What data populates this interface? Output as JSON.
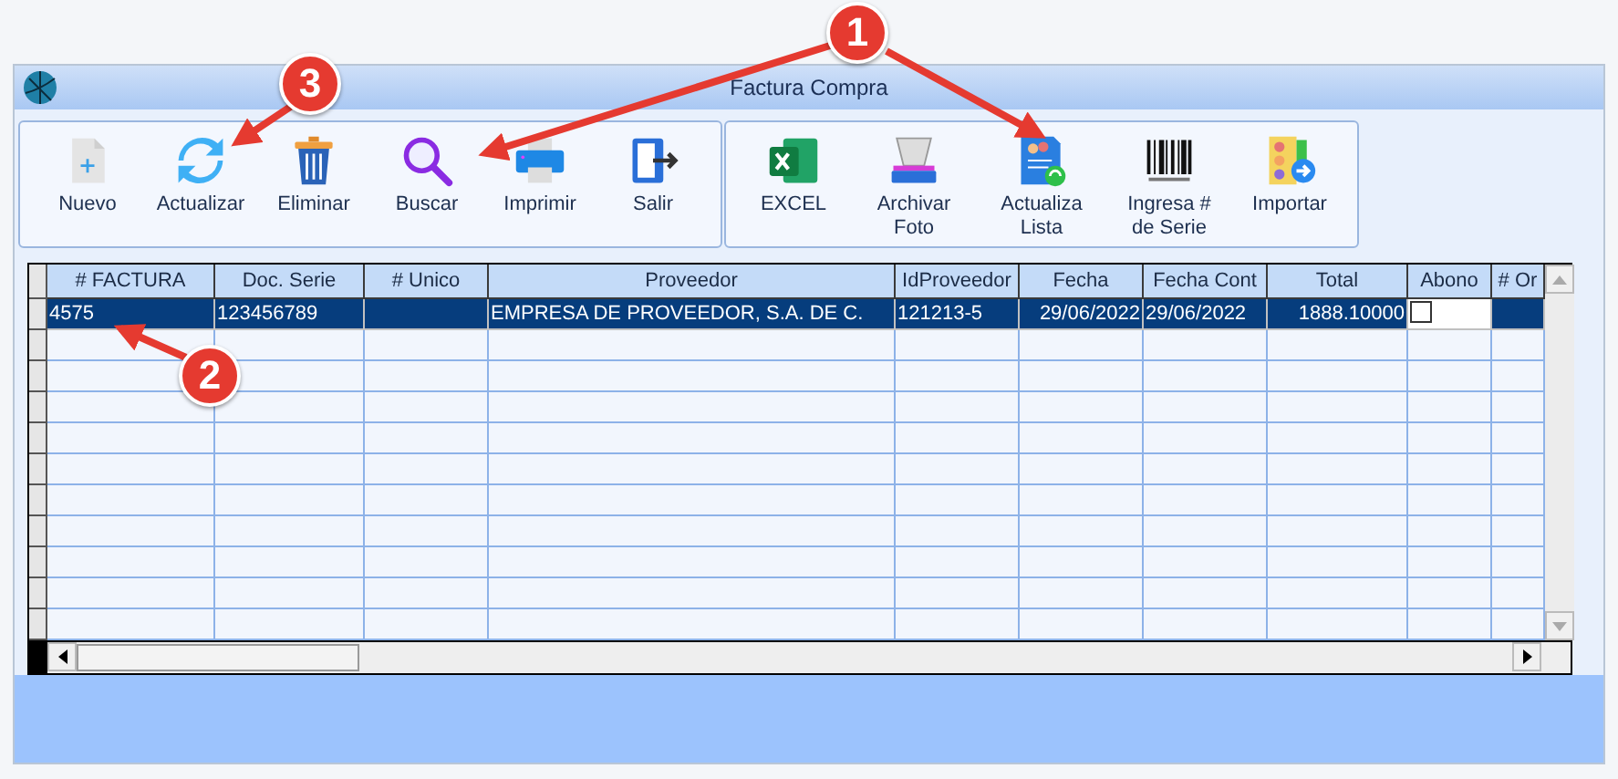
{
  "window": {
    "title": "Factura Compra"
  },
  "toolbar_groups": [
    {
      "buttons": [
        {
          "label": "Nuevo",
          "kind": "new"
        },
        {
          "label": "Actualizar",
          "kind": "refresh"
        },
        {
          "label": "Eliminar",
          "kind": "trash"
        },
        {
          "label": "Buscar",
          "kind": "search"
        },
        {
          "label": "Imprimir",
          "kind": "print"
        },
        {
          "label": "Salir",
          "kind": "exit"
        }
      ]
    },
    {
      "buttons": [
        {
          "label": "EXCEL",
          "kind": "excel"
        },
        {
          "label": "Archivar Foto",
          "kind": "scanner"
        },
        {
          "label": "Actualiza Lista",
          "kind": "list-refresh"
        },
        {
          "label": "Ingresa # de Serie",
          "kind": "barcode"
        },
        {
          "label": "Importar",
          "kind": "import"
        }
      ]
    }
  ],
  "table": {
    "columns": [
      "# FACTURA",
      "Doc. Serie",
      "# Unico",
      "Proveedor",
      "IdProveedor",
      "Fecha",
      "Fecha Cont",
      "Total",
      "Abono",
      "# Or"
    ],
    "rows": [
      {
        "selected": true,
        "cells": [
          "4575",
          "123456789",
          "",
          "EMPRESA DE PROVEEDOR, S.A. DE C.",
          "121213-5",
          "29/06/2022",
          "29/06/2022",
          "1888.10000"
        ],
        "abono_checked": false
      }
    ]
  },
  "annotations": [
    {
      "label": "1"
    },
    {
      "label": "2"
    },
    {
      "label": "3"
    }
  ]
}
